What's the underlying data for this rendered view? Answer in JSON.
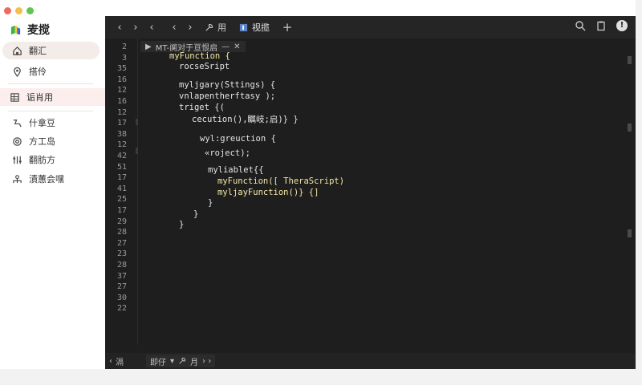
{
  "app": {
    "brand_name": "麦搅",
    "brand_colors": {
      "green": "#3bb54a",
      "yellow": "#f7c23b",
      "blue": "#2f6fd1"
    }
  },
  "sidebar": {
    "items": [
      {
        "label": "翻汇",
        "icon": "home-icon",
        "state": "active"
      },
      {
        "label": "搭伶",
        "icon": "location-pin-icon",
        "state": "normal"
      },
      {
        "label": "诟肖用",
        "icon": "grid-icon",
        "state": "highlight"
      },
      {
        "label": "什拿豆",
        "icon": "route-icon",
        "state": "normal"
      },
      {
        "label": "方工岛",
        "icon": "target-icon",
        "state": "normal"
      },
      {
        "label": "翻肪方",
        "icon": "sliders-icon",
        "state": "normal"
      },
      {
        "label": "漬蕙会嘿",
        "icon": "user-tree-icon",
        "state": "normal"
      }
    ]
  },
  "topbar": {
    "nav": [
      "‹",
      "›",
      "‹",
      "‹",
      "›"
    ],
    "tabs": [
      {
        "label": "用",
        "icon": "wrench-icon"
      },
      {
        "label": "视揽",
        "icon": "file-icon"
      }
    ],
    "add_label": "+",
    "info_label": "!"
  },
  "breadcrumb": {
    "arrow": "▶",
    "text": "MT-阒对于亘恨启",
    "minimize": "—",
    "close": "✕"
  },
  "line_numbers": [
    "2",
    "3",
    "35",
    "16",
    "12",
    "16",
    "12",
    "17",
    "38",
    "12",
    "42",
    "51",
    "17",
    "41",
    "25",
    "17",
    "29",
    "28",
    "27",
    "23",
    "28",
    "37",
    "27",
    "30",
    "22"
  ],
  "code": [
    {
      "text": "myFunction {",
      "indent": 38,
      "color": "yellow",
      "row": 1
    },
    {
      "text": "rocseSript",
      "indent": 50,
      "color": "white",
      "row": 2
    },
    {
      "text": "myljgary(Sttings) {",
      "indent": 50,
      "color": "white",
      "row": 3.7
    },
    {
      "text": "vnlapentherftasy );",
      "indent": 50,
      "color": "white",
      "row": 4.7
    },
    {
      "text": "triget {(",
      "indent": 50,
      "color": "white",
      "row": 5.7
    },
    {
      "text": "cecution(),瞩岐;启)} }",
      "indent": 66,
      "color": "white",
      "row": 6.7
    },
    {
      "text": "wyl:greuction {",
      "indent": 76,
      "color": "white",
      "row": 8.6
    },
    {
      "text": "«roject);",
      "indent": 82,
      "color": "white",
      "row": 9.9
    },
    {
      "text": "myliablet{{",
      "indent": 86,
      "color": "white",
      "row": 11.5
    },
    {
      "text": "myFunction([ TheraScript)",
      "indent": 98,
      "color": "yellow",
      "row": 12.5
    },
    {
      "text": "myljayFunction()} {]",
      "indent": 98,
      "color": "yellow",
      "row": 13.5
    },
    {
      "text": "}",
      "indent": 86,
      "color": "white",
      "row": 14.5
    },
    {
      "text": "}",
      "indent": 68,
      "color": "white",
      "row": 15.5
    },
    {
      "text": "}",
      "indent": 50,
      "color": "white",
      "row": 16.5
    }
  ],
  "bottombar": {
    "left_arrow": "‹",
    "left_label": "滆",
    "mid_label": "即仔",
    "mid_label2": "月",
    "right_arrows": "› ›"
  }
}
